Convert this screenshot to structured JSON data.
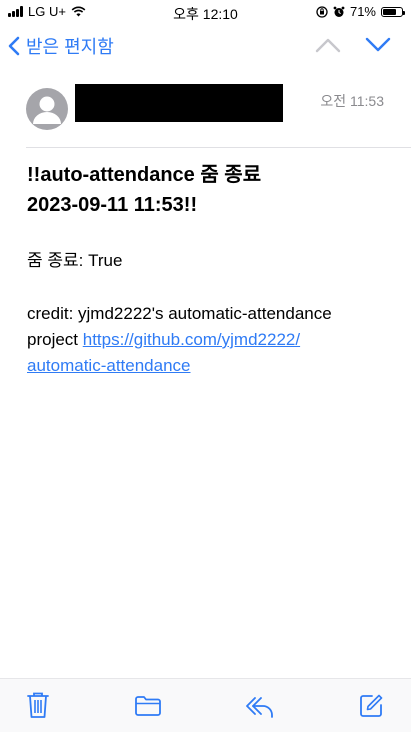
{
  "status_bar": {
    "carrier": "LG U+",
    "time": "오후 12:10",
    "battery_text": "71%",
    "battery_level": 0.71
  },
  "nav": {
    "back_label": "받은 편지함"
  },
  "email": {
    "time": "오전 11:53",
    "subject_line1": "!!auto-attendance 줌 종료",
    "subject_line2": "2023-09-11 11:53!!",
    "body_status": "줌 종료: True",
    "credit_text": "credit: yjmd2222's automatic-attendance",
    "credit_project": "project ",
    "link_part1": "https://github.com/yjmd2222/",
    "link_part2": "automatic-attendance"
  },
  "colors": {
    "accent": "#2f7bf5",
    "muted": "#8a8a8e"
  },
  "icons": [
    "signal-icon",
    "wifi-icon",
    "lock-rotation-icon",
    "alarm-icon",
    "battery-icon",
    "chevron-left-icon",
    "chevron-up-icon",
    "chevron-down-icon",
    "avatar-icon",
    "trash-icon",
    "folder-icon",
    "reply-icon",
    "compose-icon"
  ]
}
